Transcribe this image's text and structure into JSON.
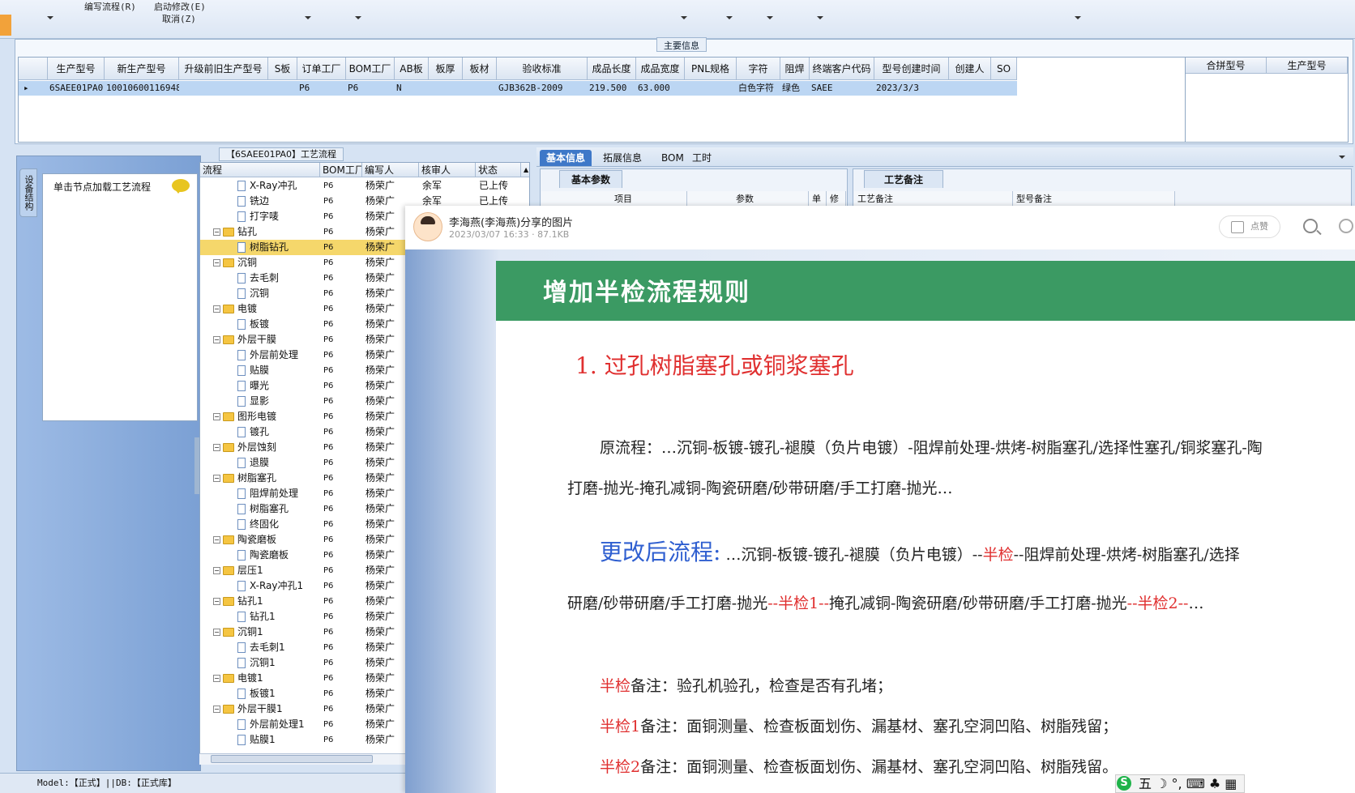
{
  "toolbar": {
    "items": [
      {
        "label": "编写流程(R)"
      },
      {
        "label": "启动修改(E)"
      },
      {
        "label": "取消(Z)"
      }
    ]
  },
  "main_info": {
    "title": "主要信息",
    "columns": [
      "生产型号",
      "新生产型号",
      "升级前旧生产型号",
      "S板",
      "订单工厂",
      "BOM工厂",
      "AB板",
      "板厚",
      "板材",
      "验收标准",
      "成品长度",
      "成品宽度",
      "PNL规格",
      "字符",
      "阻焊",
      "终端客户代码",
      "型号创建时间",
      "创建人",
      "SO"
    ],
    "row": {
      "生产型号": "6SAEE01PA0",
      "新生产型号": "10010600116948",
      "升级前旧生产型号": "",
      "S板": "",
      "订单工厂": "P6",
      "BOM工厂": "P6",
      "AB板": "N",
      "板厚": "",
      "板材": "",
      "验收标准": "GJB362B-2009",
      "成品长度": "219.500",
      "成品宽度": "63.000",
      "PNL规格": "",
      "字符": "白色字符",
      "阻焊": "绿色",
      "终端客户代码": "SAEE",
      "型号创建时间": "2023/3/3",
      "创建人": "",
      "SO": ""
    },
    "right_columns": [
      "合拼型号",
      "生产型号"
    ]
  },
  "left_panel": {
    "tab_label": "设备结构",
    "load_label": "单击节点加载工艺流程"
  },
  "process_tree": {
    "title": "【6SAEE01PA0】工艺流程",
    "columns": [
      "流程",
      "BOM工厂",
      "编写人",
      "核审人",
      "状态"
    ],
    "rows": [
      {
        "name": "X-Ray冲孔",
        "type": "doc",
        "factory": "P6",
        "writer": "杨荣广",
        "reviewer": "余军",
        "status": "已上传",
        "level": 2
      },
      {
        "name": "铣边",
        "type": "doc",
        "factory": "P6",
        "writer": "杨荣广",
        "reviewer": "余军",
        "status": "已上传",
        "level": 2
      },
      {
        "name": "打字唛",
        "type": "doc",
        "factory": "P6",
        "writer": "杨荣广",
        "reviewer": "",
        "status": "",
        "level": 2
      },
      {
        "name": "钻孔",
        "type": "folder",
        "factory": "P6",
        "writer": "杨荣广",
        "reviewer": "",
        "status": "",
        "level": 1
      },
      {
        "name": "树脂钻孔",
        "type": "doc",
        "factory": "P6",
        "writer": "杨荣广",
        "reviewer": "",
        "status": "",
        "level": 2,
        "selected": true
      },
      {
        "name": "沉铜",
        "type": "folder",
        "factory": "P6",
        "writer": "杨荣广",
        "reviewer": "",
        "status": "",
        "level": 1
      },
      {
        "name": "去毛刺",
        "type": "doc",
        "factory": "P6",
        "writer": "杨荣广",
        "reviewer": "",
        "status": "",
        "level": 2
      },
      {
        "name": "沉铜",
        "type": "doc",
        "factory": "P6",
        "writer": "杨荣广",
        "reviewer": "",
        "status": "",
        "level": 2
      },
      {
        "name": "电镀",
        "type": "folder",
        "factory": "P6",
        "writer": "杨荣广",
        "reviewer": "",
        "status": "",
        "level": 1
      },
      {
        "name": "板镀",
        "type": "doc",
        "factory": "P6",
        "writer": "杨荣广",
        "reviewer": "",
        "status": "",
        "level": 2
      },
      {
        "name": "外层干膜",
        "type": "folder",
        "factory": "P6",
        "writer": "杨荣广",
        "reviewer": "",
        "status": "",
        "level": 1
      },
      {
        "name": "外层前处理",
        "type": "doc",
        "factory": "P6",
        "writer": "杨荣广",
        "reviewer": "",
        "status": "",
        "level": 2
      },
      {
        "name": "贴膜",
        "type": "doc",
        "factory": "P6",
        "writer": "杨荣广",
        "reviewer": "",
        "status": "",
        "level": 2
      },
      {
        "name": "曝光",
        "type": "doc",
        "factory": "P6",
        "writer": "杨荣广",
        "reviewer": "",
        "status": "",
        "level": 2
      },
      {
        "name": "显影",
        "type": "doc",
        "factory": "P6",
        "writer": "杨荣广",
        "reviewer": "",
        "status": "",
        "level": 2
      },
      {
        "name": "图形电镀",
        "type": "folder",
        "factory": "P6",
        "writer": "杨荣广",
        "reviewer": "",
        "status": "",
        "level": 1
      },
      {
        "name": "镀孔",
        "type": "doc",
        "factory": "P6",
        "writer": "杨荣广",
        "reviewer": "",
        "status": "",
        "level": 2
      },
      {
        "name": "外层蚀刻",
        "type": "folder",
        "factory": "P6",
        "writer": "杨荣广",
        "reviewer": "",
        "status": "",
        "level": 1
      },
      {
        "name": "退膜",
        "type": "doc",
        "factory": "P6",
        "writer": "杨荣广",
        "reviewer": "",
        "status": "",
        "level": 2
      },
      {
        "name": "树脂塞孔",
        "type": "folder",
        "factory": "P6",
        "writer": "杨荣广",
        "reviewer": "",
        "status": "",
        "level": 1
      },
      {
        "name": "阻焊前处理",
        "type": "doc",
        "factory": "P6",
        "writer": "杨荣广",
        "reviewer": "",
        "status": "",
        "level": 2
      },
      {
        "name": "树脂塞孔",
        "type": "doc",
        "factory": "P6",
        "writer": "杨荣广",
        "reviewer": "",
        "status": "",
        "level": 2
      },
      {
        "name": "终固化",
        "type": "doc",
        "factory": "P6",
        "writer": "杨荣广",
        "reviewer": "",
        "status": "",
        "level": 2
      },
      {
        "name": "陶瓷磨板",
        "type": "folder",
        "factory": "P6",
        "writer": "杨荣广",
        "reviewer": "",
        "status": "",
        "level": 1
      },
      {
        "name": "陶瓷磨板",
        "type": "doc",
        "factory": "P6",
        "writer": "杨荣广",
        "reviewer": "",
        "status": "",
        "level": 2
      },
      {
        "name": "层压1",
        "type": "folder",
        "factory": "P6",
        "writer": "杨荣广",
        "reviewer": "",
        "status": "",
        "level": 1
      },
      {
        "name": "X-Ray冲孔1",
        "type": "doc",
        "factory": "P6",
        "writer": "杨荣广",
        "reviewer": "",
        "status": "",
        "level": 2
      },
      {
        "name": "钻孔1",
        "type": "folder",
        "factory": "P6",
        "writer": "杨荣广",
        "reviewer": "",
        "status": "",
        "level": 1
      },
      {
        "name": "钻孔1",
        "type": "doc",
        "factory": "P6",
        "writer": "杨荣广",
        "reviewer": "",
        "status": "",
        "level": 2
      },
      {
        "name": "沉铜1",
        "type": "folder",
        "factory": "P6",
        "writer": "杨荣广",
        "reviewer": "",
        "status": "",
        "level": 1
      },
      {
        "name": "去毛刺1",
        "type": "doc",
        "factory": "P6",
        "writer": "杨荣广",
        "reviewer": "",
        "status": "",
        "level": 2
      },
      {
        "name": "沉铜1",
        "type": "doc",
        "factory": "P6",
        "writer": "杨荣广",
        "reviewer": "",
        "status": "",
        "level": 2
      },
      {
        "name": "电镀1",
        "type": "folder",
        "factory": "P6",
        "writer": "杨荣广",
        "reviewer": "",
        "status": "",
        "level": 1
      },
      {
        "name": "板镀1",
        "type": "doc",
        "factory": "P6",
        "writer": "杨荣广",
        "reviewer": "",
        "status": "",
        "level": 2
      },
      {
        "name": "外层干膜1",
        "type": "folder",
        "factory": "P6",
        "writer": "杨荣广",
        "reviewer": "",
        "status": "",
        "level": 1
      },
      {
        "name": "外层前处理1",
        "type": "doc",
        "factory": "P6",
        "writer": "杨荣广",
        "reviewer": "",
        "status": "",
        "level": 2
      },
      {
        "name": "贴膜1",
        "type": "doc",
        "factory": "P6",
        "writer": "杨荣广",
        "reviewer": "",
        "status": "",
        "level": 2
      }
    ]
  },
  "right_tabs": {
    "tabs": [
      {
        "label": "基本信息",
        "active": true
      },
      {
        "label": "拓展信息",
        "active": false
      },
      {
        "label": "BOM",
        "active": false
      },
      {
        "label": "工时",
        "active": false
      }
    ],
    "basic_param_label": "基本参数",
    "craft_note_label": "工艺备注",
    "basic_param_columns": [
      "项目",
      "参数",
      "单",
      "修"
    ],
    "craft_note_columns": [
      "工艺备注",
      "型号备注"
    ]
  },
  "status_bar": {
    "text": "Model:【正式】||DB:【正式库】"
  },
  "viewer": {
    "share_title": "李海燕(李海燕)分享的图片",
    "share_meta": "2023/03/07 16:33 · 87.1KB",
    "like_label": "点赞",
    "slide": {
      "title": "增加半检流程规则",
      "heading": "1.  过孔树脂塞孔或铜浆塞孔",
      "original_label": "原流程：",
      "original_line1": "…沉铜-板镀-镀孔-褪膜（负片电镀）-阻焊前处理-烘烤-树脂塞孔/选择性塞孔/铜浆塞孔-陶",
      "original_line2": "打磨-抛光-掩孔减铜-陶瓷研磨/砂带研磨/手工打磨-抛光…",
      "changed_label": "更改后流程:",
      "changed_line1_a": "…沉铜-板镀-镀孔-褪膜（负片电镀）--",
      "changed_line1_b": "半检",
      "changed_line1_c": "--阻焊前处理-烘烤-树脂塞孔/选择",
      "changed_line2_a": "研磨/砂带研磨/手工打磨-抛光",
      "changed_line2_b": "--半检1--",
      "changed_line2_c": "掩孔减铜-陶瓷研磨/砂带研磨/手工打磨-抛光",
      "changed_line2_d": "--半检2--",
      "changed_line2_e": "…",
      "note0_red": "半检",
      "note0_rest": "备注：验孔机验孔，检查是否有孔堵；",
      "note1_red": "半检1",
      "note1_rest": "备注：面铜测量、检查板面划伤、漏基材、塞孔空洞凹陷、树脂残留；",
      "note2_red": "半检2",
      "note2_rest": "备注：面铜测量、检查板面划伤、漏基材、塞孔空洞凹陷、树脂残留。"
    }
  },
  "ime": {
    "label": "五 ☽ °, ⌨ ♣ ▦"
  }
}
